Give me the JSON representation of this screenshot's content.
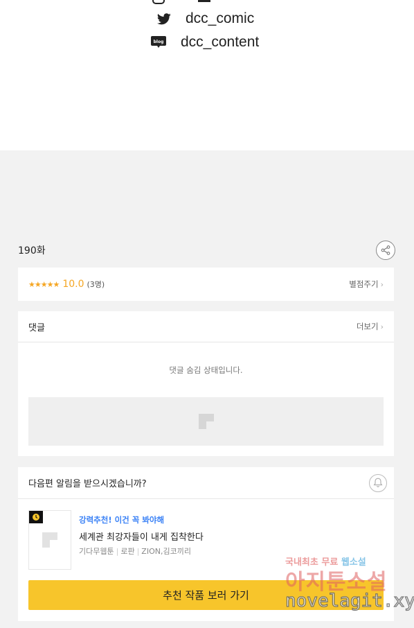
{
  "social": {
    "twitter_handle": "dcc_comic",
    "blog_handle": "dcc_content",
    "blog_icon_text": "blog"
  },
  "episode": {
    "title": "190화"
  },
  "rating": {
    "stars": "★★★★★",
    "score": "10.0",
    "count": "(3명)",
    "rate_link": "별점주기"
  },
  "comments": {
    "title": "댓글",
    "more_link": "더보기",
    "hidden_message": "댓글 숨김 상태입니다."
  },
  "notify": {
    "question": "다음편 알림을 받으시겠습니까?",
    "recommend_badge": "강력추천! 이건 꼭 봐야해",
    "recommend_title": "세계관 최강자들이 내게 집착한다",
    "meta": [
      "기다무웹툰",
      "로판",
      "ZION,김코끼리"
    ],
    "cta_label": "추천 작품 보러 가기"
  },
  "watermark": {
    "line1_a": "국내최초 무료 ",
    "line1_b": "웹소설",
    "line2": "아지툰소설",
    "line3": "novelagit.xyz"
  },
  "colors": {
    "accent_star": "#f5a623",
    "cta_yellow": "#f7c52b",
    "badge_blue": "#3b82f6",
    "page_bg": "#f2f2f2"
  }
}
